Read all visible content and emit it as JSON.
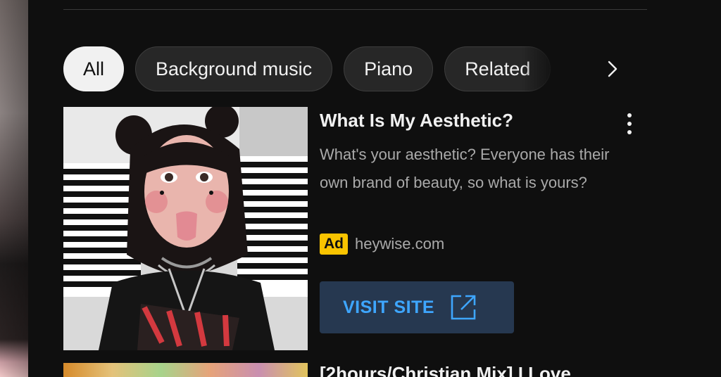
{
  "chips": {
    "items": [
      {
        "label": "All",
        "active": true
      },
      {
        "label": "Background music",
        "active": false
      },
      {
        "label": "Piano",
        "active": false
      },
      {
        "label": "Related",
        "active": false
      }
    ],
    "next_icon": "chevron-right-icon"
  },
  "ad": {
    "title": "What Is My Aesthetic?",
    "description": "What's your aesthetic? Everyone has their own brand of beauty, so what is yours?",
    "badge": "Ad",
    "domain": "heywise.com",
    "cta_label": "VISIT SITE",
    "cta_icon": "external-link-icon",
    "menu_icon": "more-vert-icon",
    "badge_color": "#f9c400",
    "cta_color": "#3ea6ff"
  },
  "next_item": {
    "title": "[2hours/Christian Mix] I Love"
  }
}
